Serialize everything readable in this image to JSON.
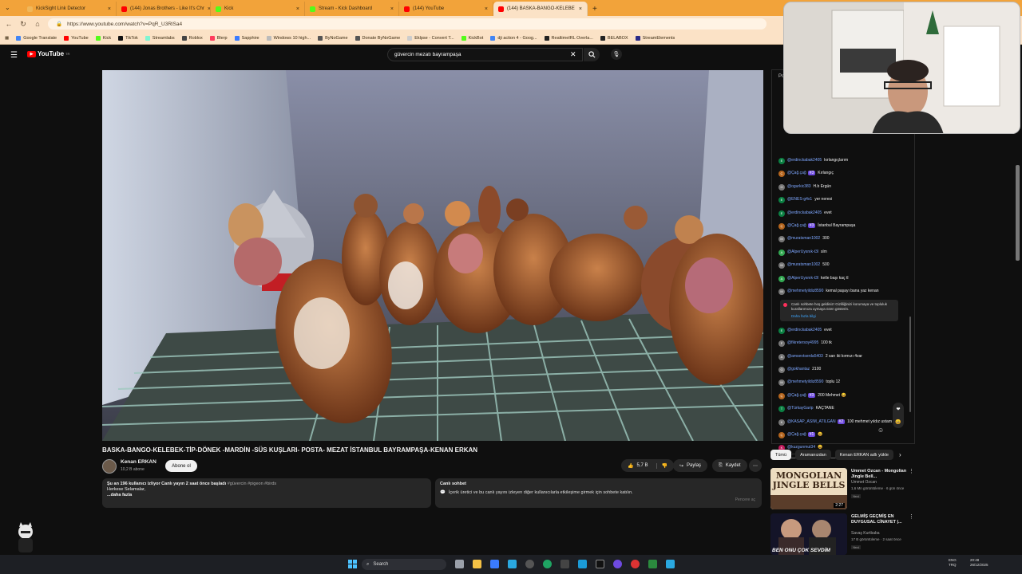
{
  "browser": {
    "tabs": [
      {
        "label": "KickSight Link Detector",
        "color": "#f0b75a"
      },
      {
        "label": "(144) Jonas Brothers - Like It's Chr",
        "color": "#ff0000"
      },
      {
        "label": "Kick",
        "color": "#53fc18"
      },
      {
        "label": "Stream - Kick Dashboard",
        "color": "#53fc18"
      },
      {
        "label": "(144) YouTube",
        "color": "#ff0000"
      },
      {
        "label": "(144) BASKA-BANGO-KELEBE",
        "color": "#ff0000"
      }
    ],
    "new_tab": "+",
    "url": "https://www.youtube.com/watch?v=PqR_U3RlSa4",
    "bookmarks": [
      {
        "label": "Google Translate",
        "color": "#4285f4"
      },
      {
        "label": "YouTube",
        "color": "#ff0000"
      },
      {
        "label": "Kick",
        "color": "#53fc18"
      },
      {
        "label": "TikTok",
        "color": "#111111"
      },
      {
        "label": "Streamlabs",
        "color": "#80f5d2"
      },
      {
        "label": "Roblox",
        "color": "#444444"
      },
      {
        "label": "Blerp",
        "color": "#ff3b5c"
      },
      {
        "label": "Sapphire",
        "color": "#3a7bff"
      },
      {
        "label": "Windows 10 high...",
        "color": "#bbbbbb"
      },
      {
        "label": "ByNoGame",
        "color": "#555555"
      },
      {
        "label": "Donate ByNoGame",
        "color": "#555555"
      },
      {
        "label": "Eklpse - Convert T...",
        "color": "#cccccc"
      },
      {
        "label": "KickBot",
        "color": "#53fc18"
      },
      {
        "label": "dji action 4 - Goog...",
        "color": "#4285f4"
      },
      {
        "label": "RealtimeIRL Overla...",
        "color": "#222222"
      },
      {
        "label": "BELABOX",
        "color": "#222222"
      },
      {
        "label": "StreamElements",
        "color": "#2a2a88"
      }
    ]
  },
  "youtube": {
    "logo": "YouTube",
    "logo_suffix": "TR",
    "search_value": "güvercin mezatı bayrampaşa",
    "video": {
      "title": "BASKA-BANGO-KELEBEK-TİP-DÖNEK -MARDİN -SÜS KUŞLARI- POSTA- MEZAT İSTANBUL BAYRAMPAŞA-KENAN ERKAN",
      "channel": "Kenan ERKAN",
      "subscribers": "10,2 B abone",
      "subscribe_label": "Abone ol",
      "likes": "5,7 B",
      "share_label": "Paylaş",
      "save_label": "Kaydet",
      "description_line1": "Şu an 196 kullanıcı izliyor  Canlı yayın 2 saat önce başladı",
      "description_tags": "#güvercin #pigeon #birds",
      "description_line2": "Herkese Selamalar,",
      "description_more": "...daha fazla"
    },
    "live_chat_panel": {
      "title": "Canlı sohbet",
      "text": "İçerik üretici ve bu canlı yayını izleyen diğer kullanıcılarla etkileşime girmek için sohbete katılın.",
      "action": "Pencere aç"
    },
    "chat": {
      "header": "Po",
      "messages": [
        {
          "initial": "E",
          "color": "#0b8043",
          "author": "@erdinckabak2405",
          "badge": "",
          "text": "kırlangıçlarım"
        },
        {
          "initial": "Ç",
          "color": "#b5651d",
          "author": "@Çağ.çağ",
          "badge": "#3",
          "text": "Kırlangıç"
        },
        {
          "initial": "O",
          "color": "#777777",
          "author": "@ogurkic383",
          "badge": "",
          "text": "H.b Ergün"
        },
        {
          "initial": "E",
          "color": "#0b8043",
          "author": "@ENES-g4x1",
          "badge": "",
          "text": "yer neresi"
        },
        {
          "initial": "E",
          "color": "#0b8043",
          "author": "@erdinckabak2405",
          "badge": "",
          "text": "evet"
        },
        {
          "initial": "Ç",
          "color": "#b5651d",
          "author": "@Çağ.çağ",
          "badge": "#3",
          "text": "İstanbul Bayrampaşa"
        },
        {
          "initial": "M",
          "color": "#777777",
          "author": "@muratsman1002",
          "badge": "",
          "text": "300"
        },
        {
          "initial": "A",
          "color": "#33a852",
          "author": "@AlperUysnık-t3l",
          "badge": "",
          "text": "slm"
        },
        {
          "initial": "M",
          "color": "#777777",
          "author": "@muratsman1002",
          "badge": "",
          "text": "500"
        },
        {
          "initial": "A",
          "color": "#33a852",
          "author": "@AlperUysnık-t3l",
          "badge": "",
          "text": "ketle başı kaç tl"
        },
        {
          "initial": "M",
          "color": "#777777",
          "author": "@mehmetyildiz8590",
          "badge": "",
          "text": "kemal paşayı bana yaz kenan"
        }
      ],
      "notice": "Canlı sohbete hoş geldiniz! Gizliliğinizi korumaya ve topluluk kurallarımıza uymaya özen gösterin.",
      "notice_link": "Daha fazla bilgi",
      "messages2": [
        {
          "initial": "E",
          "color": "#0b8043",
          "author": "@erdinckabak2405",
          "badge": "",
          "text": "evet"
        },
        {
          "initial": "F",
          "color": "#777777",
          "author": "@fikretersoy4995",
          "badge": "",
          "text": "100 tk"
        },
        {
          "initial": "A",
          "color": "#777777",
          "author": "@amsevtserda5403",
          "badge": "",
          "text": "2 sarı iki kırmızı 4var"
        },
        {
          "initial": "G",
          "color": "#777777",
          "author": "@gokhantaz",
          "badge": "",
          "text": "2100"
        },
        {
          "initial": "M",
          "color": "#777777",
          "author": "@mehmetyildiz8590",
          "badge": "",
          "text": "toplu 12"
        },
        {
          "initial": "Ç",
          "color": "#b5651d",
          "author": "@Çağ.çağ",
          "badge": "#3",
          "text": "200 Mehmet 😀"
        },
        {
          "initial": "T",
          "color": "#0b8043",
          "author": "@TürkayGarip",
          "badge": "",
          "text": "KAÇTANE"
        },
        {
          "initial": "K",
          "color": "#777777",
          "author": "@KASAP_ASIM_ATILGAN",
          "badge": "#2",
          "text": "100 mehmet yıldız ustam"
        },
        {
          "initial": "Ç",
          "color": "#b5651d",
          "author": "@Çağ.çağ",
          "badge": "#1",
          "text": "😀"
        },
        {
          "initial": "K",
          "color": "#c2185b",
          "author": "@kuzgunmut34",
          "badge": "",
          "text": "😀"
        }
      ],
      "input_placeholder": "Sohbet..."
    },
    "filters": [
      "Tümü",
      "Aramanızdan",
      "Kenan ERKAN adlı yükle"
    ],
    "recommendations": [
      {
        "title": "Ummet Ozcan - Mongolian Jingle Bell...",
        "channel": "Ummet Ozcan",
        "meta": "1,6 Mn görüntüleme · 6 gün önce",
        "badge": "Yeni",
        "thumb_text": "MONGOLIAN JINGLE BELLS",
        "duration": "2:27"
      },
      {
        "title": "GELMİŞ GEÇMİŞ EN DUYGUSAL CİNAYET |...",
        "channel": "Savaş Kurtbaba",
        "meta": "17 B görüntüleme · 2 saat önce",
        "badge": "Yeni",
        "thumb_text": "BEN ONU ÇOK SEVDİM",
        "duration": ""
      }
    ]
  },
  "taskbar": {
    "search": "Search",
    "lang": "ENG\nTRQ",
    "time": "20:48",
    "date": "26/12/2025"
  }
}
